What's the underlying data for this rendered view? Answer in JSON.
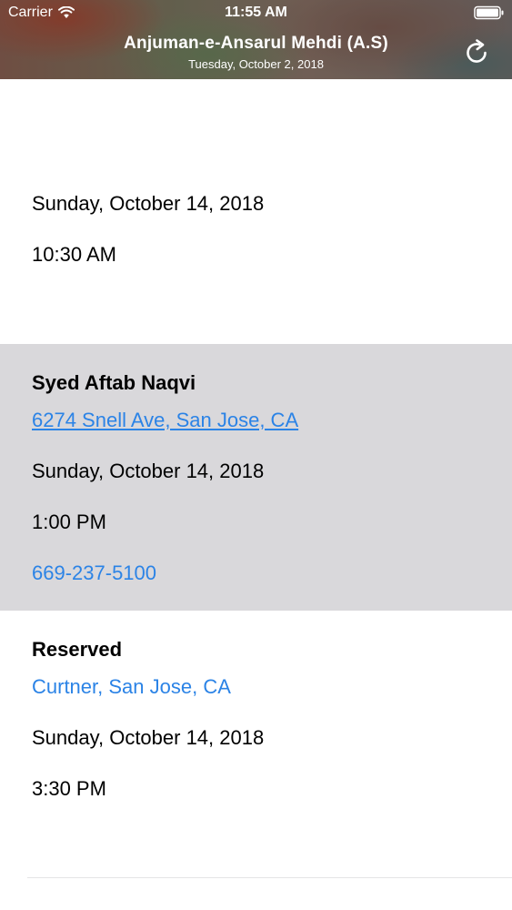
{
  "status_bar": {
    "carrier": "Carrier",
    "time": "11:55 AM",
    "wifi_icon": "wifi-icon",
    "battery_icon": "battery-icon"
  },
  "nav": {
    "title": "Anjuman-e-Ansarul Mehdi (A.S)",
    "subtitle": "Tuesday, October 2, 2018",
    "refresh_icon": "refresh-icon"
  },
  "colors": {
    "link": "#2b83e6",
    "highlight_background": "#d9d8db",
    "separator": "#e4e4e6"
  },
  "events": [
    {
      "date": "Sunday, October 14, 2018",
      "time": "10:30 AM"
    },
    {
      "host": "Syed Aftab Naqvi",
      "address": "6274 Snell Ave, San Jose, CA",
      "date": "Sunday, October 14, 2018",
      "time": "1:00 PM",
      "phone": "669-237-5100",
      "selected": true
    },
    {
      "host": "Reserved",
      "address": "Curtner, San Jose, CA",
      "date": "Sunday, October 14, 2018",
      "time": "3:30 PM"
    }
  ]
}
